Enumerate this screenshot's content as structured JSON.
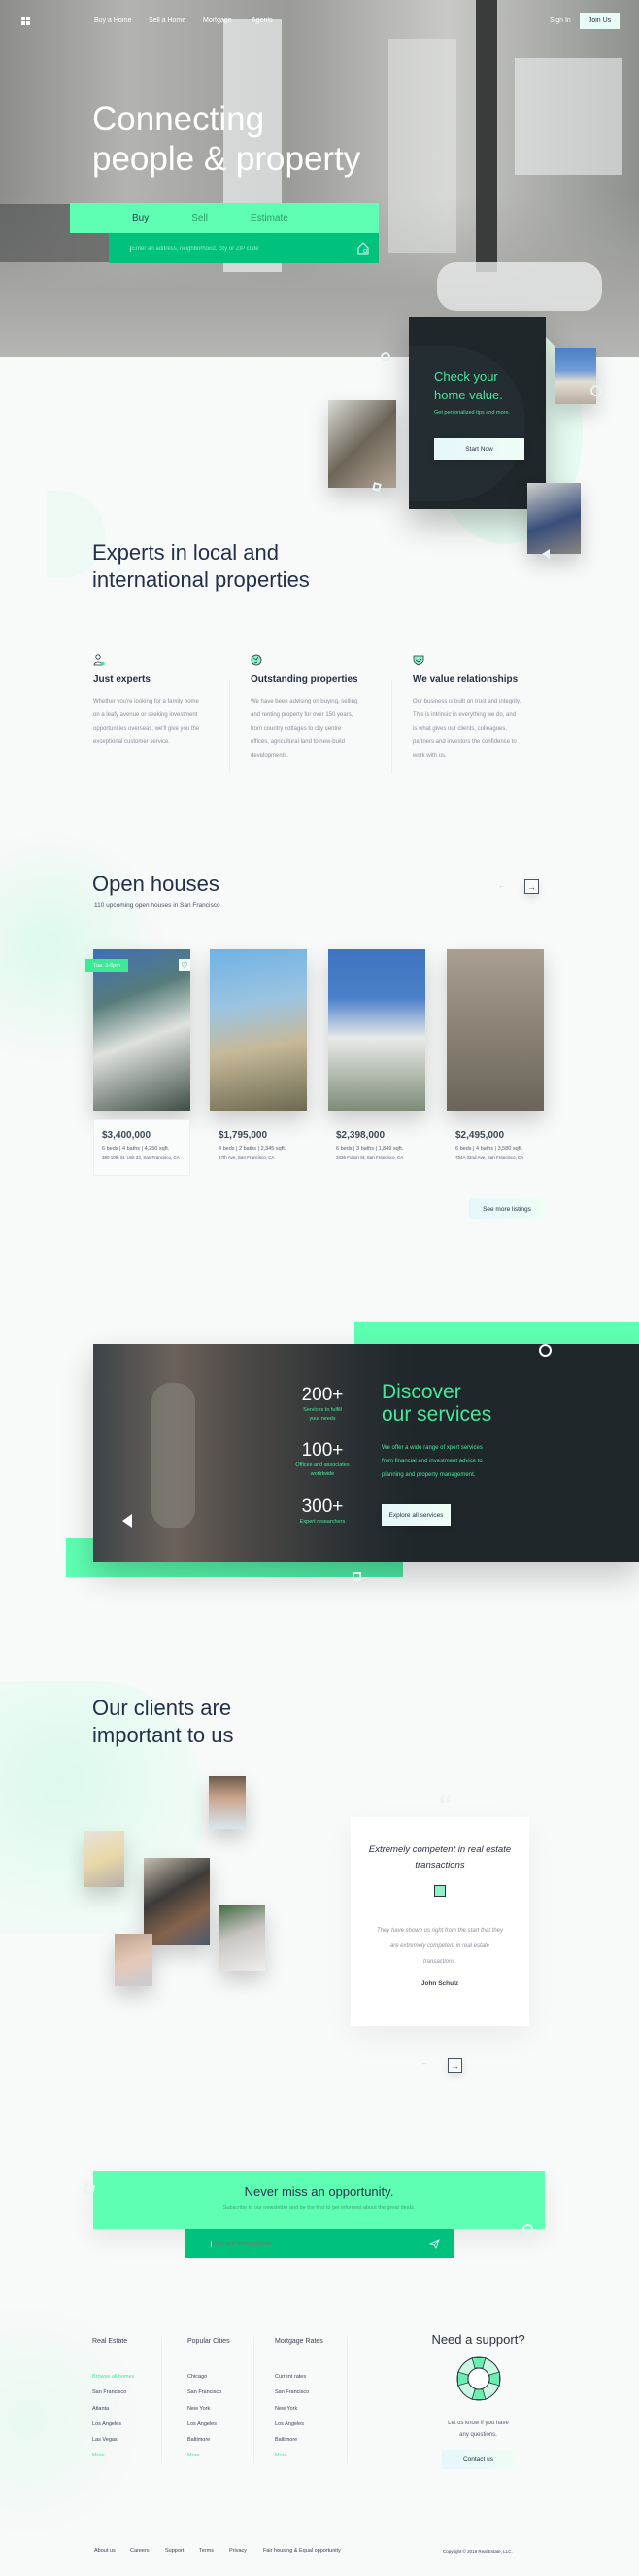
{
  "header": {
    "nav": [
      "Buy a Home",
      "Sell a Home",
      "Mortgage",
      "Agents"
    ],
    "active_nav": "Buy a Home",
    "sign_in": "Sign In",
    "join": "Join Us"
  },
  "hero": {
    "title_line1": "Connecting",
    "title_line2": "people & property",
    "tabs": [
      "Buy",
      "Sell",
      "Estimate"
    ],
    "active_tab": "Buy",
    "search_placeholder": "Enter an address, neighborhood, city or ZIP code",
    "search_icon": "house-search-icon"
  },
  "home_value": {
    "title_line1": "Check your",
    "title_line2": "home value.",
    "subtitle": "Get personalized tips and more.",
    "button": "Start Now"
  },
  "experts": {
    "title_line1": "Experts in local and",
    "title_line2": "international properties",
    "features": [
      {
        "icon": "user-star-icon",
        "title": "Just experts",
        "text": "Whether you're looking for a family home on a leafy avenue or seeking investment opportunities overseas, we'll give you the exceptional customer service."
      },
      {
        "icon": "globe-icon",
        "title": "Outstanding properties",
        "text": "We have been advising on buying, selling and renting property for over 150 years, from country cottages to city centre offices, agricultural land to new-build developments."
      },
      {
        "icon": "handshake-shield-icon",
        "title": "We value relationships",
        "text": "Our business is built on trust and integrity. This is intrinsic in everything we do, and is what gives our clients, colleagues, partners and investors the confidence to work with us."
      }
    ]
  },
  "open_houses": {
    "title": "Open houses",
    "subtitle": "110 upcoming open houses in San Francisco",
    "badge": "Tue. 3-6pm",
    "listings": [
      {
        "price": "$3,400,000",
        "beds": "6 beds",
        "baths": "4 baths",
        "sqft": "4,250 sqft.",
        "address": "380 10th St. Unit 23, San Francisco, CA"
      },
      {
        "price": "$1,795,000",
        "beds": "4 beds",
        "baths": "2 baths",
        "sqft": "2,345 sqft.",
        "address": "47th Ave, San Francisco, CA"
      },
      {
        "price": "$2,398,000",
        "beds": "6 beds",
        "baths": "3 baths",
        "sqft": "1,849 sqft.",
        "address": "3336 Fulton St, San Francisco, CA"
      },
      {
        "price": "$2,495,000",
        "beds": "6 beds",
        "baths": "4 baths",
        "sqft": "3,580 sqft.",
        "address": "754A 32nd Ave, San Francisco, CA"
      }
    ],
    "see_more": "See more listings"
  },
  "services": {
    "title_line1": "Discover",
    "title_line2": "our services",
    "text": "We offer a wide range of xpert services from financial and investment advice to planning and property management.",
    "button": "Explore all services",
    "stats": [
      {
        "value": "200+",
        "label": "Services to fulfill your needs"
      },
      {
        "value": "100+",
        "label": "Offices and associates worldwide"
      },
      {
        "value": "300+",
        "label": "Expert researchers"
      }
    ]
  },
  "clients": {
    "title_line1": "Our clients are",
    "title_line2": "important to us",
    "testimonial": {
      "title": "Extremely competent in real estate transactions",
      "text": "They have shown us right from the start that they are extremely competent in real estate transactions.",
      "author": "John Schulz"
    }
  },
  "newsletter": {
    "title": "Never miss an opportunity.",
    "subtitle": "Subscribe to our newsletter and be the first to get informed about the great deals.",
    "placeholder": "Enter your email address."
  },
  "footer": {
    "columns": [
      {
        "heading": "Real Estate",
        "items": [
          "Browse all homes",
          "San Francisco",
          "Atlanta",
          "Los Angeles",
          "Las Vegas",
          "More"
        ]
      },
      {
        "heading": "Popular Cities",
        "items": [
          "Chicago",
          "San Francisco",
          "New York",
          "Los Angeles",
          "Baltimore",
          "More"
        ]
      },
      {
        "heading": "Mortgage Rates",
        "items": [
          "Current rates",
          "San Francisco",
          "New York",
          "Los Angeles",
          "Baltimore",
          "More"
        ]
      }
    ],
    "support": {
      "title": "Need a support?",
      "text_line1": "Let us know if you have",
      "text_line2": "any questions.",
      "button": "Contact us"
    },
    "links": [
      "About us",
      "Careers",
      "Support",
      "Terms",
      "Privacy",
      "Fair housing & Equal opportunity"
    ],
    "copyright": "Copyright © 2018 Real Estate, LLC."
  },
  "colors": {
    "accent": "#5effb2",
    "accent_dark": "#00c27d",
    "dark": "#1f272b",
    "text": "#24304a"
  }
}
